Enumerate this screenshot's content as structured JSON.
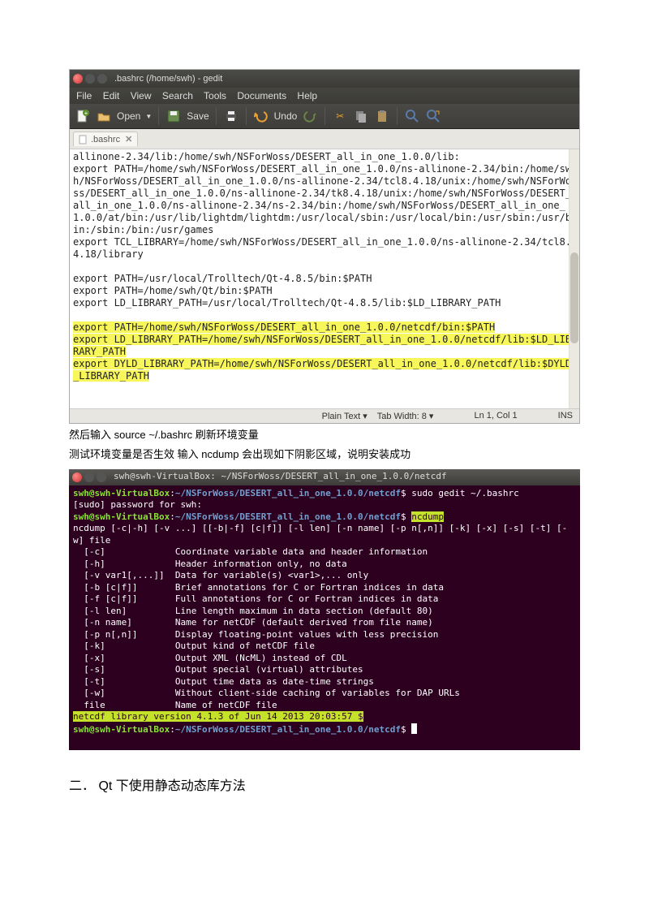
{
  "gedit": {
    "title": ".bashrc (/home/swh) - gedit",
    "menus": [
      "File",
      "Edit",
      "View",
      "Search",
      "Tools",
      "Documents",
      "Help"
    ],
    "open": "Open",
    "save": "Save",
    "undo": "Undo",
    "tab": ".bashrc",
    "bodyA": "allinone-2.34/lib:/home/swh/NSForWoss/DESERT_all_in_one_1.0.0/lib:\nexport PATH=/home/swh/NSForWoss/DESERT_all_in_one_1.0.0/ns-allinone-2.34/bin:/home/swh/NSForWoss/DESERT_all_in_one_1.0.0/ns-allinone-2.34/tcl8.4.18/unix:/home/swh/NSForWoss/DESERT_all_in_one_1.0.0/ns-allinone-2.34/tk8.4.18/unix:/home/swh/NSForWoss/DESERT_all_in_one_1.0.0/ns-allinone-2.34/ns-2.34/bin:/home/swh/NSForWoss/DESERT_all_in_one_1.0.0/at/bin:/usr/lib/lightdm/lightdm:/usr/local/sbin:/usr/local/bin:/usr/sbin:/usr/bin:/sbin:/bin:/usr/games\nexport TCL_LIBRARY=/home/swh/NSForWoss/DESERT_all_in_one_1.0.0/ns-allinone-2.34/tcl8.4.18/library\n\nexport PATH=/usr/local/Trolltech/Qt-4.8.5/bin:$PATH\nexport PATH=/home/swh/Qt/bin:$PATH\nexport LD_LIBRARY_PATH=/usr/local/Trolltech/Qt-4.8.5/lib:$LD_LIBRARY_PATH\n",
    "bodyB": "\nexport PATH=/home/swh/NSForWoss/DESERT_all_in_one_1.0.0/netcdf/bin:$PATH\nexport LD_LIBRARY_PATH=/home/swh/NSForWoss/DESERT_all_in_one_1.0.0/netcdf/lib:$LD_LIBRARY_PATH\nexport DYLD_LIBRARY_PATH=/home/swh/NSForWoss/DESERT_all_in_one_1.0.0/netcdf/lib:$DYLD_LIBRARY_PATH",
    "status": {
      "mode": "Plain Text  ▾",
      "tabw": "Tab Width: 8  ▾",
      "pos": "Ln 1, Col 1",
      "ins": "INS"
    }
  },
  "para1": "然后输入 source ~/.bashrc 刷新环境变量",
  "para2": "测试环境变量是否生效 输入 ncdump 会出现如下阴影区域，说明安装成功",
  "term": {
    "title": "swh@swh-VirtualBox: ~/NSForWoss/DESERT_all_in_one_1.0.0/netcdf",
    "p1_user": "swh@swh-VirtualBox",
    "p1_path": "~/NSForWoss/DESERT_all_in_one_1.0.0/netcdf",
    "p1_cmd": "sudo gedit ~/.bashrc",
    "sudo": "[sudo] password for swh:",
    "cmd2": "ncdump",
    "help": "ncdump [-c|-h] [-v ...] [[-b|-f] [c|f]] [-l len] [-n name] [-p n[,n]] [-k] [-x] [-s] [-t] [-w] file\n  [-c]             Coordinate variable data and header information\n  [-h]             Header information only, no data\n  [-v var1[,...]]  Data for variable(s) <var1>,... only\n  [-b [c|f]]       Brief annotations for C or Fortran indices in data\n  [-f [c|f]]       Full annotations for C or Fortran indices in data\n  [-l len]         Line length maximum in data section (default 80)\n  [-n name]        Name for netCDF (default derived from file name)\n  [-p n[,n]]       Display floating-point values with less precision\n  [-k]             Output kind of netCDF file\n  [-x]             Output XML (NcML) instead of CDL\n  [-s]             Output special (virtual) attributes\n  [-t]             Output time data as date-time strings\n  [-w]             Without client-side caching of variables for DAP URLs\n  file             Name of netCDF file",
    "ver": "netcdf library version 4.1.3 of Jun 14 2013 20:03:57 $"
  },
  "h2": "二． Qt 下使用静态动态库方法"
}
